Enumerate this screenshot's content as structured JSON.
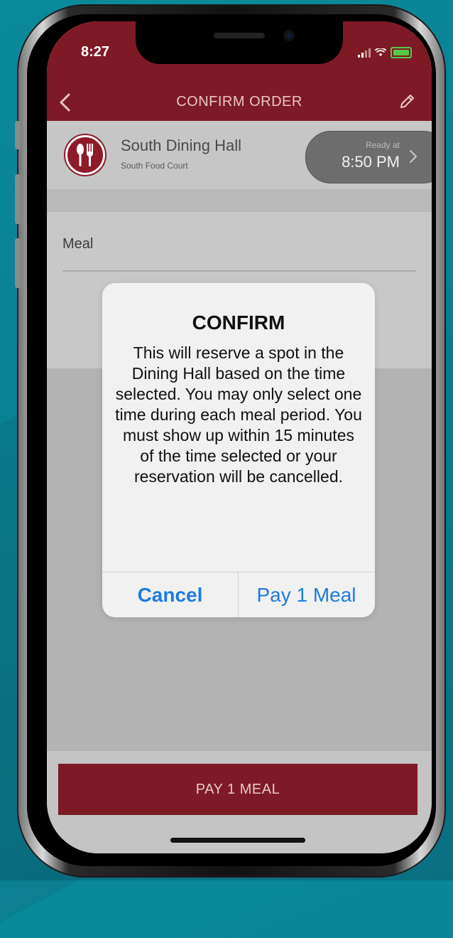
{
  "status_bar": {
    "time": "8:27"
  },
  "nav": {
    "title": "CONFIRM ORDER"
  },
  "location": {
    "name": "South Dining Hall",
    "subtitle": "South Food Court",
    "ready_label": "Ready at",
    "ready_time": "8:50 PM"
  },
  "order": {
    "item_label": "Meal"
  },
  "alert": {
    "title": "CONFIRM",
    "message": "This will reserve a spot in the Dining Hall based on the time selected.  You may only select one time during each meal period.  You must show up within 15 minutes of the time selected or your reservation will be cancelled.",
    "cancel_label": "Cancel",
    "confirm_label": "Pay 1 Meal"
  },
  "footer": {
    "pay_button_label": "PAY 1 MEAL"
  },
  "colors": {
    "brand": "#7e1a25",
    "alert_button": "#1f7be0",
    "background": "#0b8a9c"
  },
  "icons": [
    "back-chevron-icon",
    "edit-pencil-icon",
    "dining-utensils-icon",
    "chevron-right-icon",
    "signal-icon",
    "wifi-icon",
    "battery-icon"
  ]
}
